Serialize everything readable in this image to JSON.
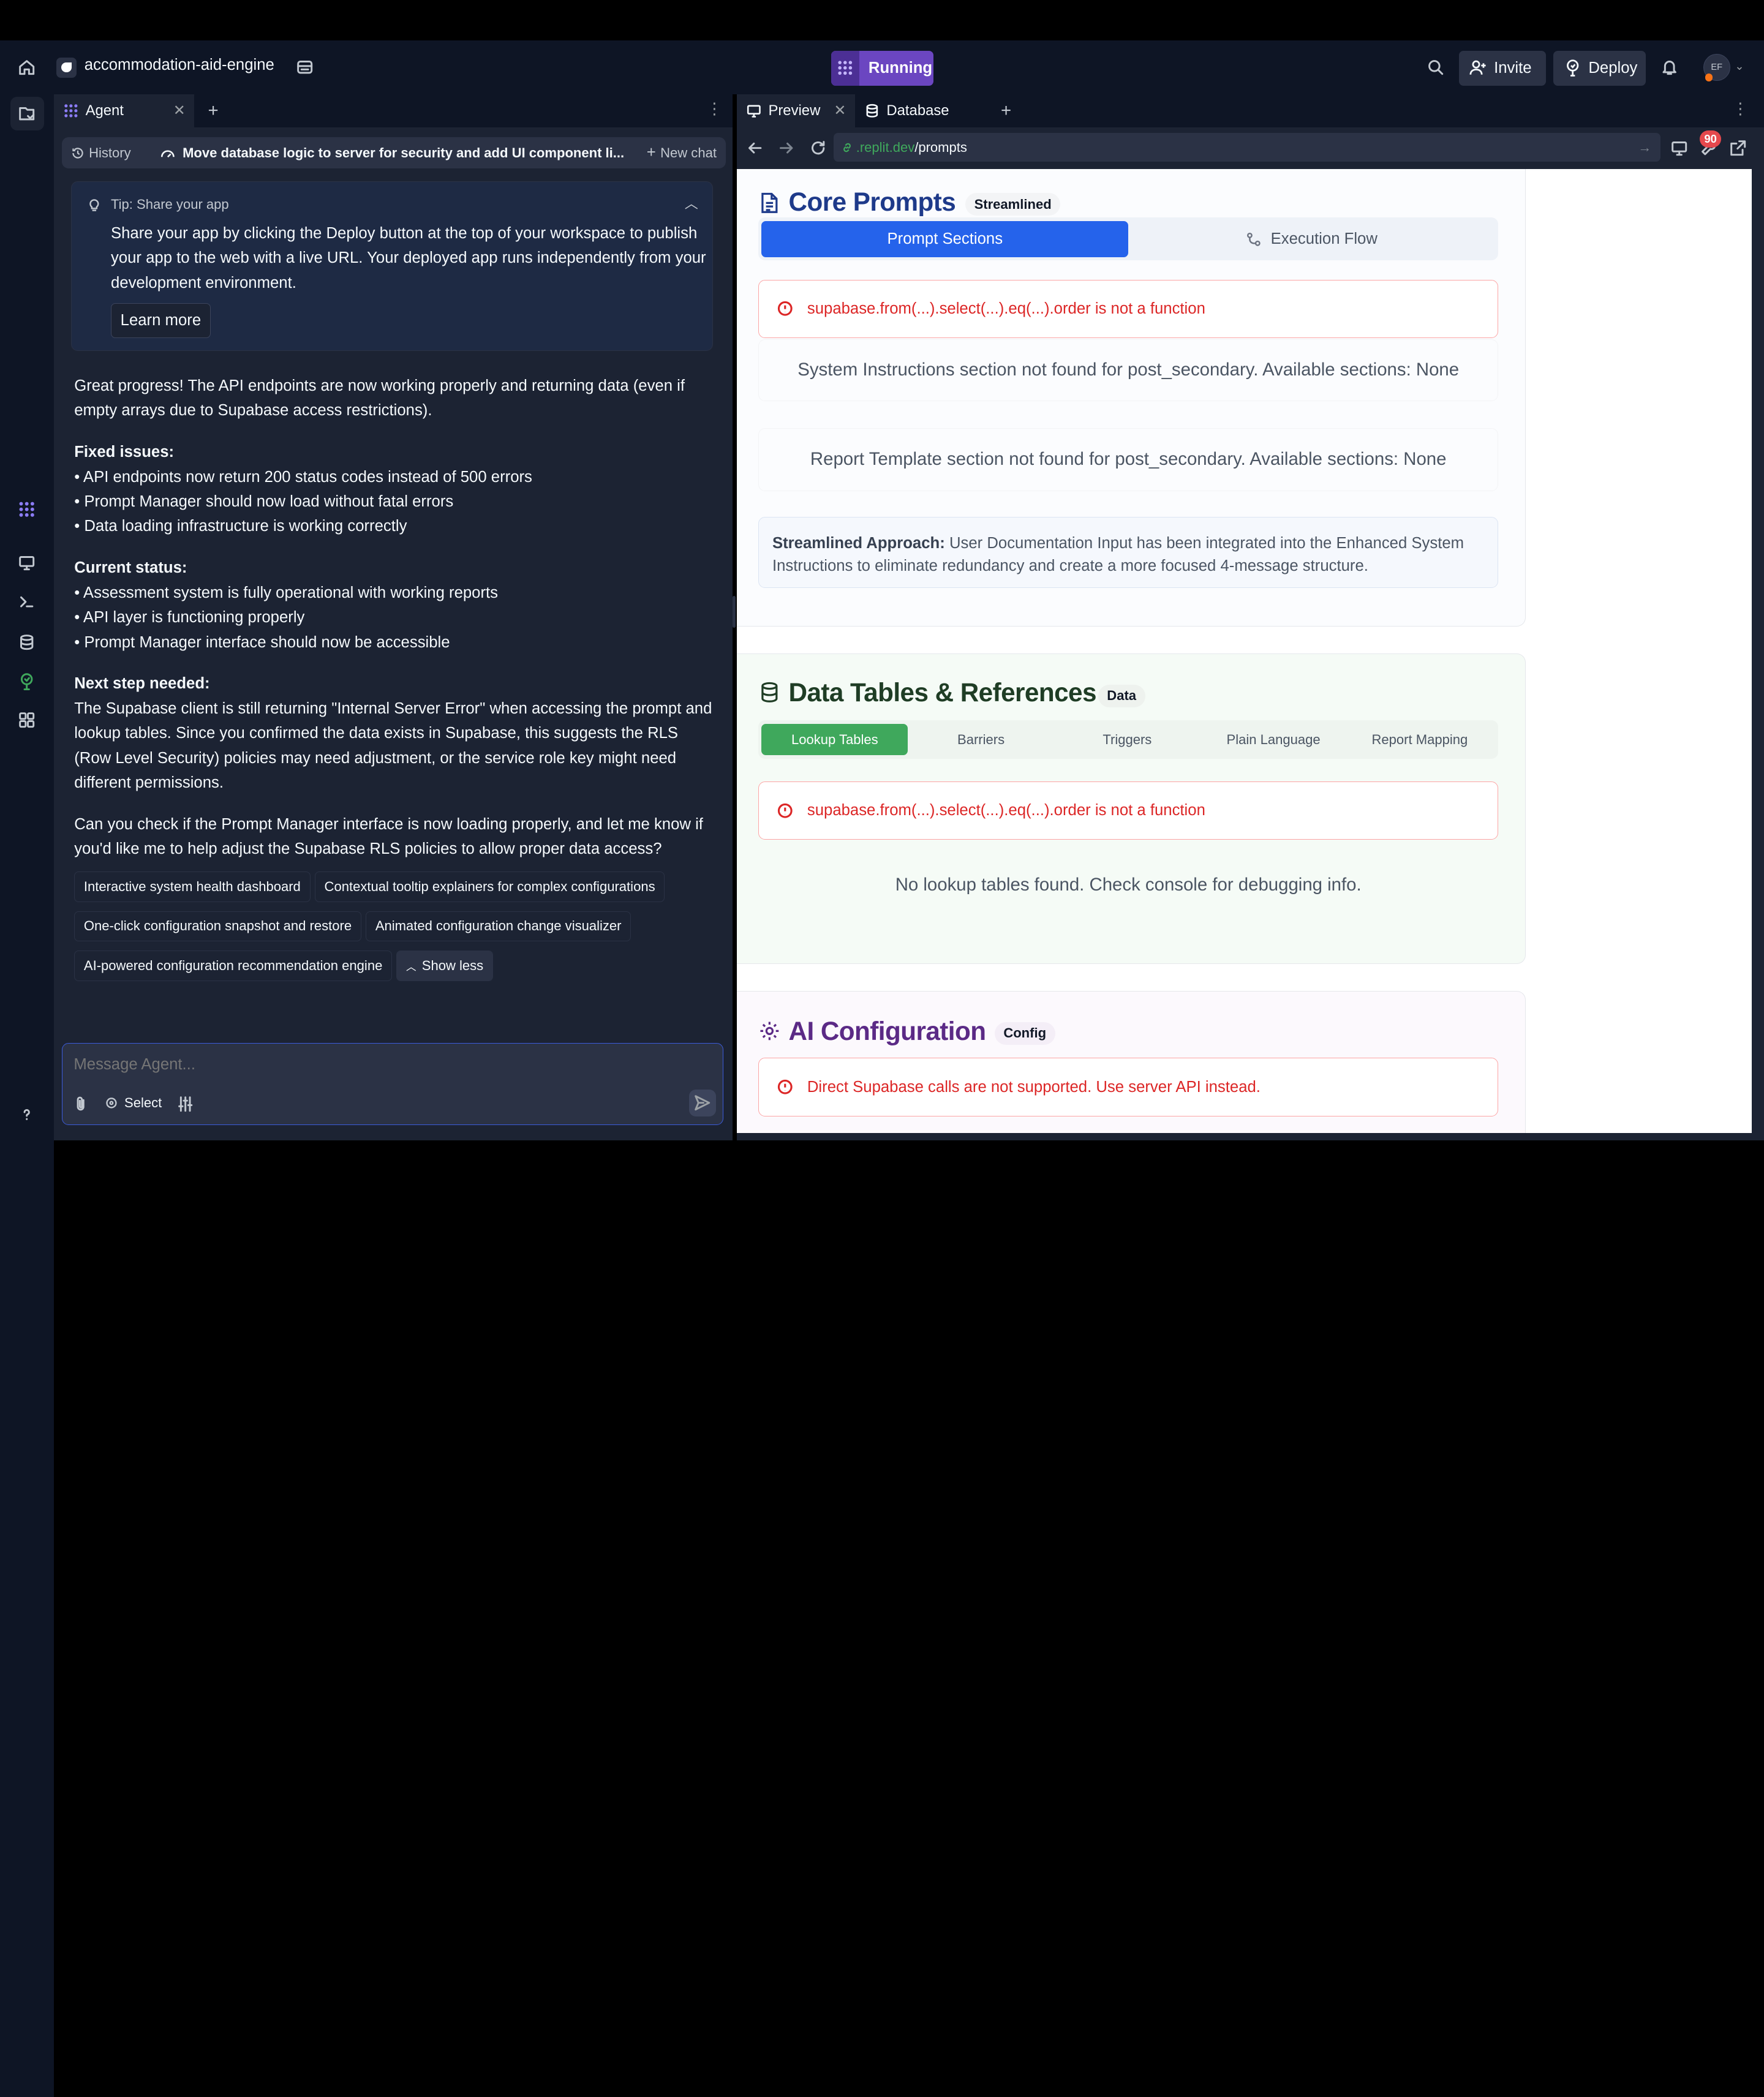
{
  "topbar": {
    "project_name": "accommodation-aid-engine",
    "status": "Running",
    "invite_label": "Invite",
    "deploy_label": "Deploy",
    "avatar_initials": "EF"
  },
  "agent": {
    "tab_label": "Agent",
    "history_label": "History",
    "thread_title": "Move database logic to server for security and add UI component li...",
    "new_chat_label": "New chat",
    "tip": {
      "title": "Tip: Share your app",
      "body": "Share your app by clicking the Deploy button at the top of your workspace to publish your app to the web with a live URL. Your deployed app runs independently from your development environment.",
      "button": "Learn more"
    },
    "message": {
      "intro": "Great progress! The API endpoints are now working properly and returning data (even if empty arrays due to Supabase access restrictions).",
      "fixed_heading": "Fixed issues:",
      "fixed_items": [
        "• API endpoints now return 200 status codes instead of 500 errors",
        "• Prompt Manager should now load without fatal errors",
        "• Data loading infrastructure is working correctly"
      ],
      "status_heading": "Current status:",
      "status_items": [
        "• Assessment system is fully operational with working reports",
        "• API layer is functioning properly",
        "• Prompt Manager interface should now be accessible"
      ],
      "next_heading": "Next step needed:",
      "next_body": "The Supabase client is still returning \"Internal Server Error\" when accessing the prompt and lookup tables. Since you confirmed the data exists in Supabase, this suggests the RLS (Row Level Security) policies may need adjustment, or the service role key might need different permissions.",
      "question": "Can you check if the Prompt Manager interface is now loading properly, and let me know if you'd like me to help adjust the Supabase RLS policies to allow proper data access?"
    },
    "suggestions": [
      "Interactive system health dashboard",
      "Contextual tooltip explainers for complex configurations",
      "One-click configuration snapshot and restore",
      "Animated configuration change visualizer",
      "AI-powered configuration recommendation engine"
    ],
    "show_less_label": "Show less",
    "input_placeholder": "Message Agent...",
    "select_label": "Select"
  },
  "preview": {
    "tab_preview": "Preview",
    "tab_database": "Database",
    "url_domain": ".replit.dev",
    "url_path": "/prompts",
    "notification_count": "90"
  },
  "page": {
    "core": {
      "title": "Core Prompts",
      "badge": "Streamlined",
      "tabs": [
        "Prompt Sections",
        "Execution Flow"
      ],
      "error": "supabase.from(...).select(...).eq(...).order is not a function",
      "notice1": "System Instructions section not found for post_secondary. Available sections: None",
      "notice2": "Report Template section not found for post_secondary. Available sections: None",
      "info_bold": "Streamlined Approach:",
      "info_text": " User Documentation Input has been integrated into the Enhanced System Instructions to eliminate redundancy and create a more focused 4-message structure."
    },
    "data": {
      "title": "Data Tables & References",
      "badge": "Data",
      "tabs": [
        "Lookup Tables",
        "Barriers",
        "Triggers",
        "Plain Language",
        "Report Mapping"
      ],
      "error": "supabase.from(...).select(...).eq(...).order is not a function",
      "empty": "No lookup tables found. Check console for debugging info."
    },
    "ai": {
      "title": "AI Configuration",
      "badge": "Config",
      "error": "Direct Supabase calls are not supported. Use server API instead."
    }
  },
  "colors": {
    "app_bg": "#0e1525",
    "panel_bg": "#1c2333",
    "running_accent": "#6b46c1",
    "core_blue": "#2563eb",
    "data_green": "#3fa85c",
    "ai_purple": "#5b2a86",
    "error_red": "#dc2626"
  }
}
